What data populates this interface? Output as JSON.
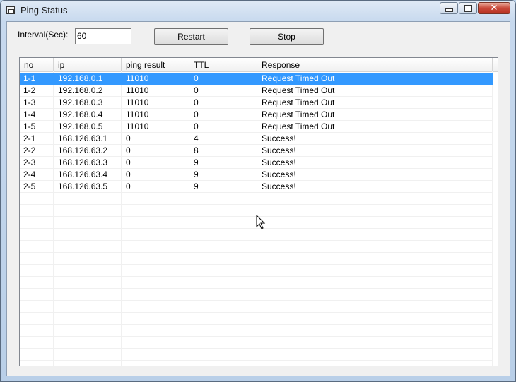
{
  "window": {
    "title": "Ping Status",
    "close_glyph": "✕"
  },
  "controls": {
    "interval_label": "Interval(Sec):",
    "interval_value": "60",
    "restart_label": "Restart",
    "stop_label": "Stop"
  },
  "table": {
    "columns": [
      "no",
      "ip",
      "ping result",
      "TTL",
      "Response"
    ],
    "selected_row": 0,
    "rows": [
      [
        "1-1",
        "192.168.0.1",
        "11010",
        "0",
        "Request Timed Out"
      ],
      [
        "1-2",
        "192.168.0.2",
        "11010",
        "0",
        "Request Timed Out"
      ],
      [
        "1-3",
        "192.168.0.3",
        "11010",
        "0",
        "Request Timed Out"
      ],
      [
        "1-4",
        "192.168.0.4",
        "11010",
        "0",
        "Request Timed Out"
      ],
      [
        "1-5",
        "192.168.0.5",
        "11010",
        "0",
        "Request Timed Out"
      ],
      [
        "2-1",
        "168.126.63.1",
        "0",
        "4",
        "Success!"
      ],
      [
        "2-2",
        "168.126.63.2",
        "0",
        "8",
        "Success!"
      ],
      [
        "2-3",
        "168.126.63.3",
        "0",
        "9",
        "Success!"
      ],
      [
        "2-4",
        "168.126.63.4",
        "0",
        "9",
        "Success!"
      ],
      [
        "2-5",
        "168.126.63.5",
        "0",
        "9",
        "Success!"
      ]
    ],
    "empty_rows": 14
  },
  "colors": {
    "selection": "#3399ff",
    "client_bg": "#f0f0f0"
  }
}
